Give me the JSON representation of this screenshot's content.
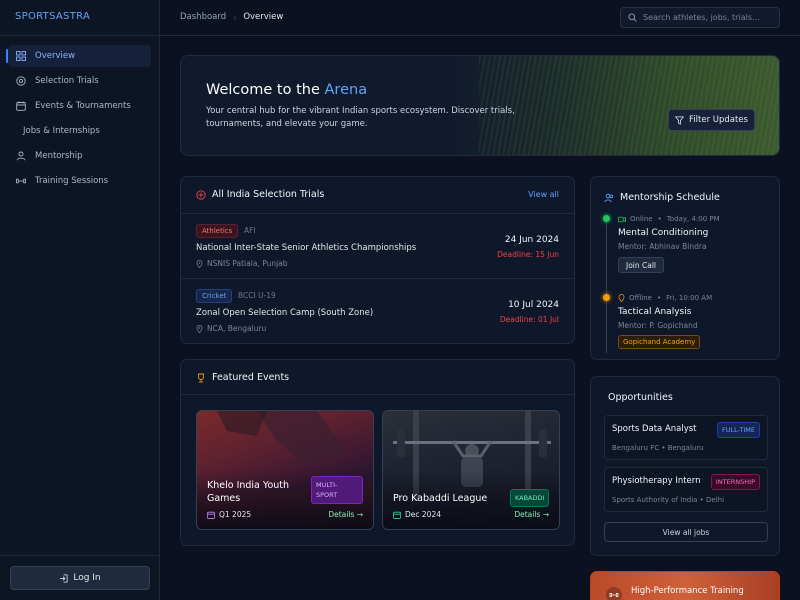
{
  "app": {
    "brand": "SPORTSASTRA"
  },
  "sidebar": {
    "items": [
      {
        "label": "Overview",
        "icon": "grid-icon",
        "active": true
      },
      {
        "label": "Selection Trials",
        "icon": "target-icon"
      },
      {
        "label": "Events & Tournaments",
        "icon": "calendar-icon"
      },
      {
        "label": "Jobs & Internships",
        "icon": ""
      },
      {
        "label": "Mentorship",
        "icon": "users-icon"
      },
      {
        "label": "Training Sessions",
        "icon": "dumbbell-icon"
      }
    ],
    "login_label": "Log In"
  },
  "header": {
    "breadcrumb": [
      "Dashboard",
      "Overview"
    ],
    "search_placeholder": "Search athletes, jobs, trials..."
  },
  "hero": {
    "title_prefix": "Welcome to the",
    "title_highlight": "Arena",
    "description": "Your central hub for the vibrant Indian sports ecosystem. Discover trials, tournaments, and elevate your game.",
    "filter_label": "Filter Updates"
  },
  "trials": {
    "title": "All India Selection Trials",
    "view_all": "View all",
    "items": [
      {
        "sport": "Athletics",
        "org": "AFI",
        "title": "National Inter-State Senior Athletics Championships",
        "location": "NSNIS Patiala, Punjab",
        "date": "24 Jun 2024",
        "deadline": "Deadline: 15 Jun"
      },
      {
        "sport": "Cricket",
        "org": "BCCI U-19",
        "title": "Zonal Open Selection Camp (South Zone)",
        "location": "NCA, Bengaluru",
        "date": "10 Jul 2024",
        "deadline": "Deadline: 01 Jul"
      }
    ]
  },
  "events": {
    "title": "Featured Events",
    "items": [
      {
        "title": "Khelo India Youth Games",
        "badge": "MULTI-SPORT",
        "date": "Q1 2025",
        "details": "Details →"
      },
      {
        "title": "Pro Kabaddi League",
        "badge": "KABADDI",
        "date": "Dec 2024",
        "details": "Details →"
      }
    ]
  },
  "mentorship": {
    "title": "Mentorship Schedule",
    "sessions": [
      {
        "status": "Online",
        "time": "Today, 4:00 PM",
        "title": "Mental Conditioning",
        "mentor": "Mentor: Abhinav Bindra",
        "action": "Join Call",
        "status_color": "#22c55e"
      },
      {
        "status": "Offline",
        "time": "Fri, 10:00 AM",
        "title": "Tactical Analysis",
        "mentor": "Mentor: P. Gopichand",
        "tag": "Gopichand Academy",
        "status_color": "#f59e0b"
      }
    ]
  },
  "opportunities": {
    "title": "Opportunities",
    "items": [
      {
        "title": "Sports Data Analyst",
        "badge": "FULL-TIME",
        "sub": "Bengaluru FC • Bengaluru"
      },
      {
        "title": "Physiotherapy Intern",
        "badge": "INTERNSHIP",
        "sub": "Sports Authority of India • Delhi"
      }
    ],
    "view_all": "View all jobs"
  },
  "training": {
    "title": "High-Performance Training"
  },
  "colors": {
    "accent": "#3b82f6",
    "background": "#0b1120",
    "danger": "#ef4444",
    "success": "#22c55e",
    "warning": "#f59e0b"
  }
}
